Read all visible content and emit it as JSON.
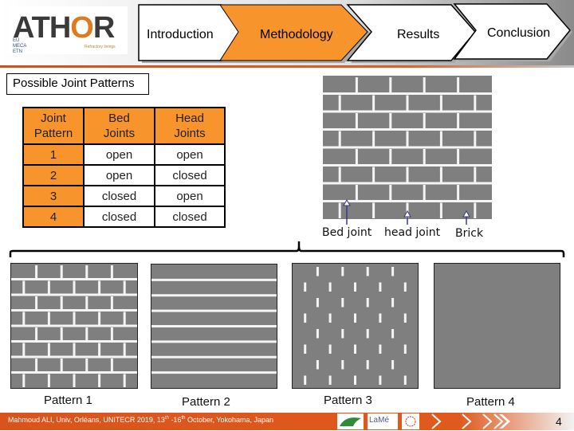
{
  "logo": {
    "name": "ATHOR",
    "subtitle_lines": [
      "EU",
      "MECA",
      "ETN"
    ],
    "tagline": "Refractory linings"
  },
  "nav": {
    "steps": [
      {
        "label": "Introduction",
        "active": false
      },
      {
        "label": "Methodology",
        "active": true
      },
      {
        "label": "Results",
        "active": false
      },
      {
        "label": "Conclusion",
        "active": false
      }
    ],
    "active_color": "#f7952c"
  },
  "section_title": "Possible Joint Patterns",
  "table": {
    "headers": [
      "Joint Pattern",
      "Bed Joints",
      "Head Joints"
    ],
    "header_lines": [
      [
        "Joint",
        "Pattern"
      ],
      [
        "Bed",
        "Joints"
      ],
      [
        "Head",
        "Joints"
      ]
    ],
    "rows": [
      [
        "1",
        "open",
        "open"
      ],
      [
        "2",
        "open",
        "closed"
      ],
      [
        "3",
        "closed",
        "open"
      ],
      [
        "4",
        "closed",
        "closed"
      ]
    ]
  },
  "diagram": {
    "annotations": [
      "Bed joint",
      "head joint",
      "Brick"
    ]
  },
  "patterns": [
    {
      "label": "Pattern 1",
      "bed_joints": "open",
      "head_joints": "open"
    },
    {
      "label": "Pattern 2",
      "bed_joints": "open",
      "head_joints": "closed"
    },
    {
      "label": "Pattern 3",
      "bed_joints": "closed",
      "head_joints": "open"
    },
    {
      "label": "Pattern 4",
      "bed_joints": "closed",
      "head_joints": "closed"
    }
  ],
  "footer": {
    "text_before_1": "Mahmoud ALI, Univ, Orléans, UNITECR 2019, 13",
    "sup_1": "th",
    "text_mid": " -16",
    "sup_2": "th",
    "text_after": " October, Yokohama, Japan",
    "partners": [
      "Univ Orléans",
      "LaMé",
      "UNITECR"
    ],
    "page_number": "4"
  },
  "colors": {
    "accent_orange": "#f7952c",
    "footer_orange": "#d9541c",
    "brick_gray": "#7f7f7f"
  }
}
